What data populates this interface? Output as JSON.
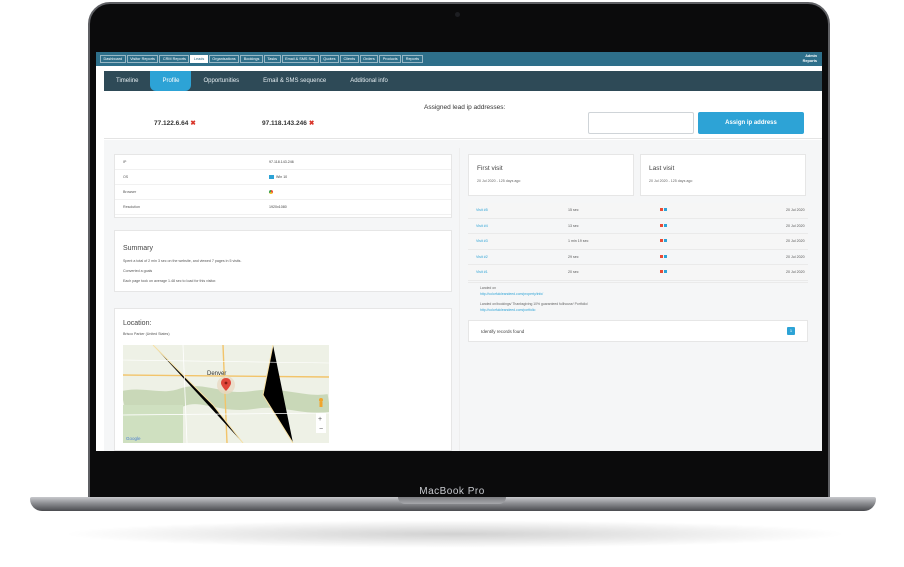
{
  "device": {
    "brand_label": "MacBook Pro"
  },
  "topnav": {
    "items": [
      "Dashboard",
      "Visitor Reports",
      "CRM Reports",
      "Leads",
      "Organisations",
      "Bookings",
      "Tasks",
      "Email & SMS Seq",
      "Quotes",
      "Clients",
      "Orders",
      "Products",
      "Reports"
    ],
    "active_index": 3,
    "user_line1": "Admin",
    "user_line2": "Reports"
  },
  "subnav": {
    "tabs": [
      "Timeline",
      "Profile",
      "Opportunities",
      "Email & SMS sequence",
      "Additional info"
    ],
    "active_index": 1
  },
  "ip_section": {
    "label": "Assigned lead ip addresses:",
    "ips": [
      "77.122.6.64",
      "97.118.143.246"
    ],
    "remove_icon": "✖",
    "input_placeholder": "",
    "assign_button": "Assign ip address"
  },
  "details": {
    "rows": [
      {
        "key": "IP",
        "value": "97.118.143.246"
      },
      {
        "key": "OS",
        "value": "Win 10"
      },
      {
        "key": "Browser",
        "value": ""
      },
      {
        "key": "Resolution",
        "value": "1920x1080"
      }
    ]
  },
  "summary": {
    "heading": "Summary",
    "lines": [
      "Spent a total of 2 min 3 sec on the website, and viewed 7 pages in 5 visits.",
      "Converted a goals",
      "Each page took on average 1.48 sec to load for this visitor."
    ]
  },
  "location": {
    "heading": "Location:",
    "address": "Brisco Parker (United States)",
    "map_city": "Denver"
  },
  "visits": {
    "first": {
      "heading": "First visit",
      "date": "20 Jul 2020 - 125 days ago"
    },
    "last": {
      "heading": "Last visit",
      "date": "20 Jul 2020 - 125 days ago"
    }
  },
  "visit_rows": [
    {
      "label": "Visit #5",
      "duration": "15 sec",
      "date": "20 Jul 2020"
    },
    {
      "label": "Visit #4",
      "duration": "13 sec",
      "date": "20 Jul 2020"
    },
    {
      "label": "Visit #3",
      "duration": "1 min 19 sec",
      "date": "20 Jul 2020"
    },
    {
      "label": "Visit #2",
      "duration": "29 sec",
      "date": "20 Jul 2020"
    },
    {
      "label": "Visit #1",
      "duration": "20 sec",
      "date": "20 Jul 2020"
    }
  ],
  "links": {
    "item1_title": "Landed on",
    "item1_url": "http://colorfulcleandeed.com/property/info/",
    "item2_title": "Landed on/bookings/ Thanksgiving 10% guaranteed fullhouse/ Portfolio/",
    "item2_url": "http://colorfulcleandeed.com/portfolio"
  },
  "records": {
    "label": "Identify records found",
    "badge": "1"
  },
  "colors": {
    "nav": "#2e6f8a",
    "subnav": "#2e4a57",
    "accent": "#2da3d6",
    "remove": "#d9362b"
  }
}
